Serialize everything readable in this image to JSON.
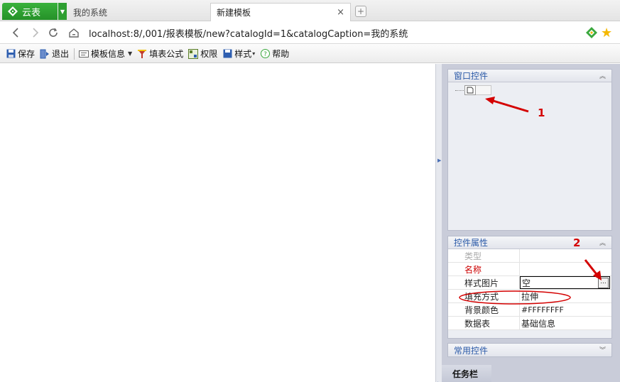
{
  "browser": {
    "brand_title": "云表",
    "tabs": [
      {
        "label": "我的系统",
        "active": false
      },
      {
        "label": "新建模板",
        "active": true
      }
    ],
    "tab_close_glyph": "×",
    "new_tab_glyph": "+",
    "url": "localhost:8/,001/报表模板/new?catalogId=1&catalogCaption=我的系统"
  },
  "toolbar": {
    "save_label": "保存",
    "exit_label": "退出",
    "template_info_label": "模板信息",
    "fill_formula_label": "填表公式",
    "permission_label": "权限",
    "style_label": "样式",
    "help_label": "帮助"
  },
  "window_controls_panel": {
    "title": "窗口控件"
  },
  "properties_panel": {
    "title": "控件属性",
    "rows": [
      {
        "key": "类型",
        "value": "",
        "key_style": "gray"
      },
      {
        "key": "名称",
        "value": "",
        "key_style": "red"
      },
      {
        "key": "样式图片",
        "value": "空",
        "key_style": "normal",
        "editing": true
      },
      {
        "key": "填充方式",
        "value": "拉伸",
        "key_style": "normal"
      },
      {
        "key": "背景颜色",
        "value": "#FFFFFFFF",
        "key_style": "normal"
      },
      {
        "key": "数据表",
        "value": "基础信息",
        "key_style": "normal"
      }
    ],
    "ellipsis_label": "..."
  },
  "common_controls_panel": {
    "title": "常用控件"
  },
  "taskbar": {
    "label": "任务栏"
  },
  "annotations": {
    "label_1": "1",
    "label_2": "2",
    "color": "#d40000"
  }
}
